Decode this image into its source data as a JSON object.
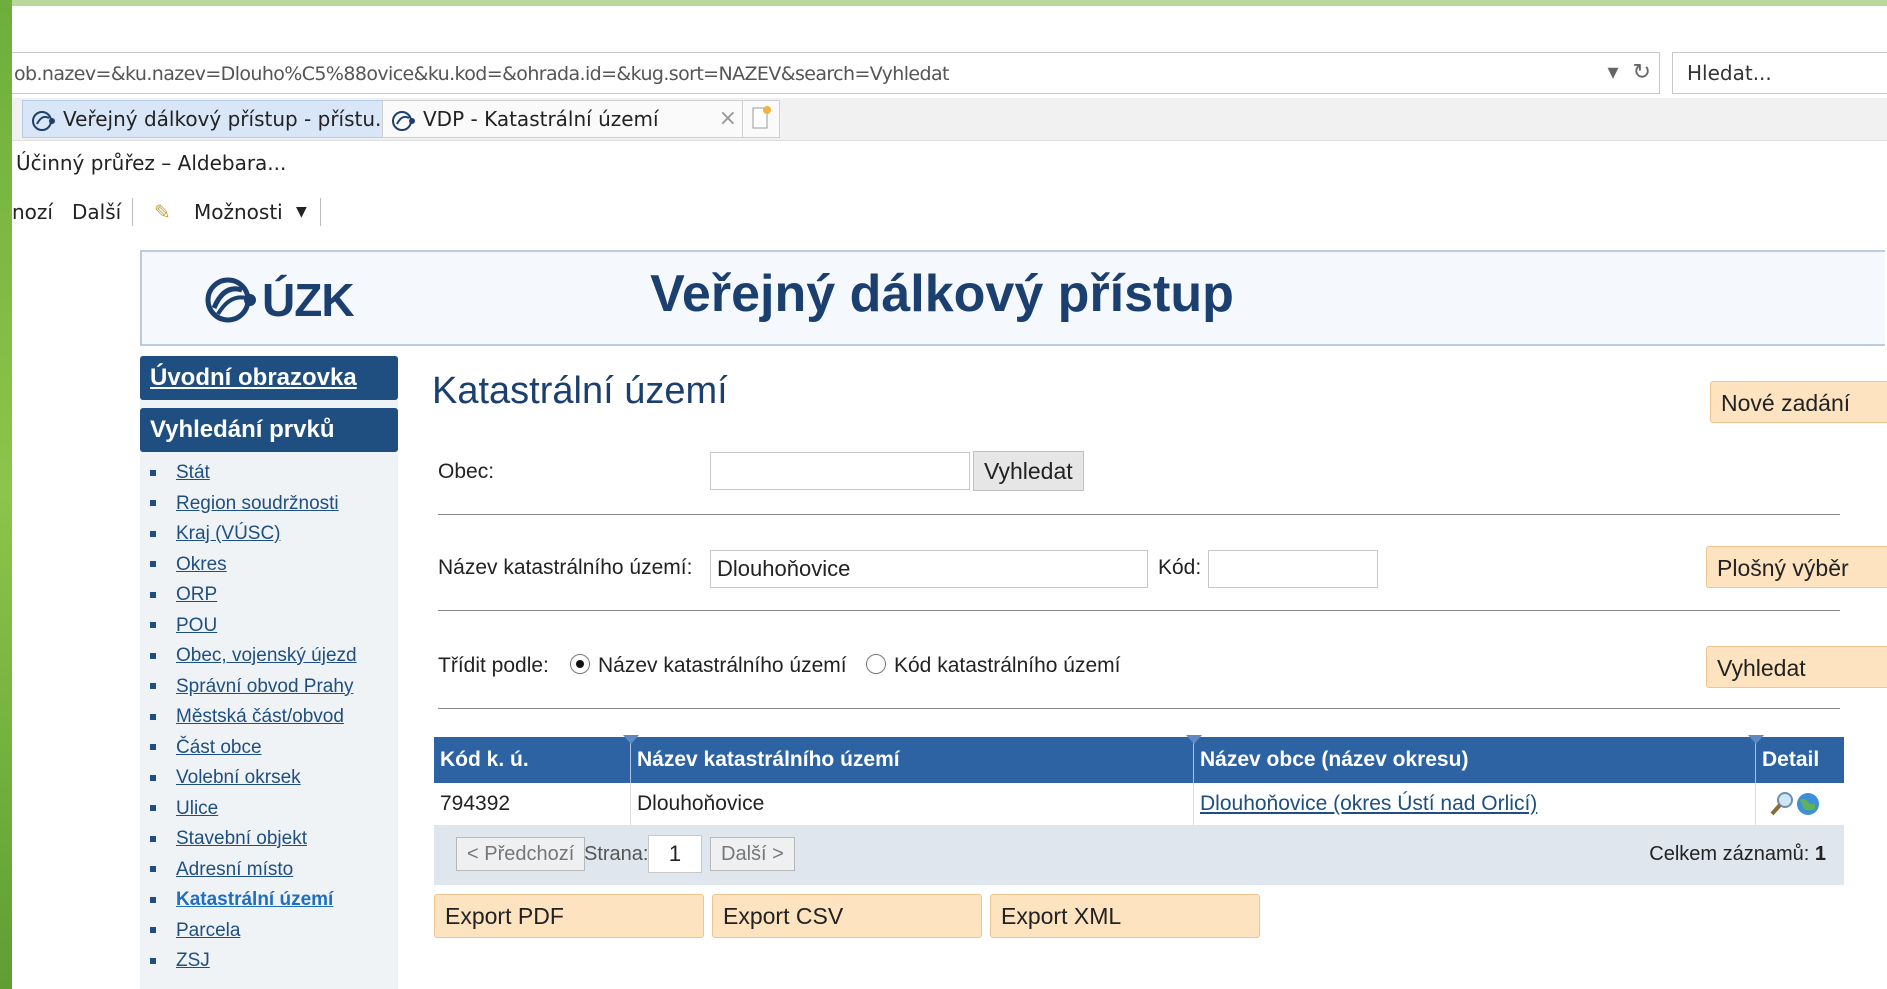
{
  "browser": {
    "url": "ob.nazev=&ku.nazev=Dlouho%C5%88ovice&ku.kod=&ohrada.id=&kug.sort=NAZEV&search=Vyhledat",
    "search_placeholder": "Hledat...",
    "tabs": [
      {
        "label": "Veřejný dálkový přístup - přístu..."
      },
      {
        "label": "VDP - Katastrální území"
      }
    ],
    "favorite": "Účinný průřez – Aldebara...",
    "cmd_prev": "nozí",
    "cmd_next": "Další",
    "cmd_options": "Možnosti"
  },
  "header": {
    "logo_text": "ÚZK",
    "title": "Veřejný dálkový přístup"
  },
  "sidebar": {
    "home": "Úvodní obrazovka",
    "search_heading": "Vyhledání prvků",
    "items": [
      "Stát",
      "Region soudržnosti",
      "Kraj (VÚSC)",
      "Okres",
      "ORP",
      "POU",
      "Obec, vojenský újezd",
      "Správní obvod Prahy",
      "Městská část/obvod",
      "Část obce",
      "Volební okrsek",
      "Ulice",
      "Stavební objekt",
      "Adresní místo",
      "Katastrální území",
      "Parcela",
      "ZSJ"
    ],
    "active_index": 14
  },
  "main": {
    "heading": "Katastrální území",
    "new_query": "Nové zadání",
    "obec_label": "Obec:",
    "obec_value": "",
    "obec_search": "Vyhledat",
    "ku_name_label": "Název katastrálního území:",
    "ku_name_value": "Dlouhoňovice",
    "kod_label": "Kód:",
    "kod_value": "",
    "area_select": "Plošný výběr",
    "sort_label": "Třídit podle:",
    "sort_option_name": "Název katastrálního území",
    "sort_option_code": "Kód katastrálního území",
    "search": "Vyhledat"
  },
  "table": {
    "columns": [
      "Kód k. ú.",
      "Název katastrálního území",
      "Název obce (název okresu)",
      "Detail"
    ],
    "rows": [
      {
        "code": "794392",
        "name": "Dlouhoňovice",
        "municipality": "Dlouhoňovice (okres Ústí nad Orlicí)"
      }
    ],
    "pager": {
      "prev": "< Předchozí",
      "page_label": "Strana:",
      "page": "1",
      "next": "Další >",
      "total_label": "Celkem záznamů:",
      "total": "1"
    }
  },
  "exports": [
    "Export PDF",
    "Export CSV",
    "Export XML"
  ],
  "colors": {
    "nav_blue": "#1e4f80",
    "table_header": "#2d63a3",
    "orange_button": "#fde3bf"
  }
}
